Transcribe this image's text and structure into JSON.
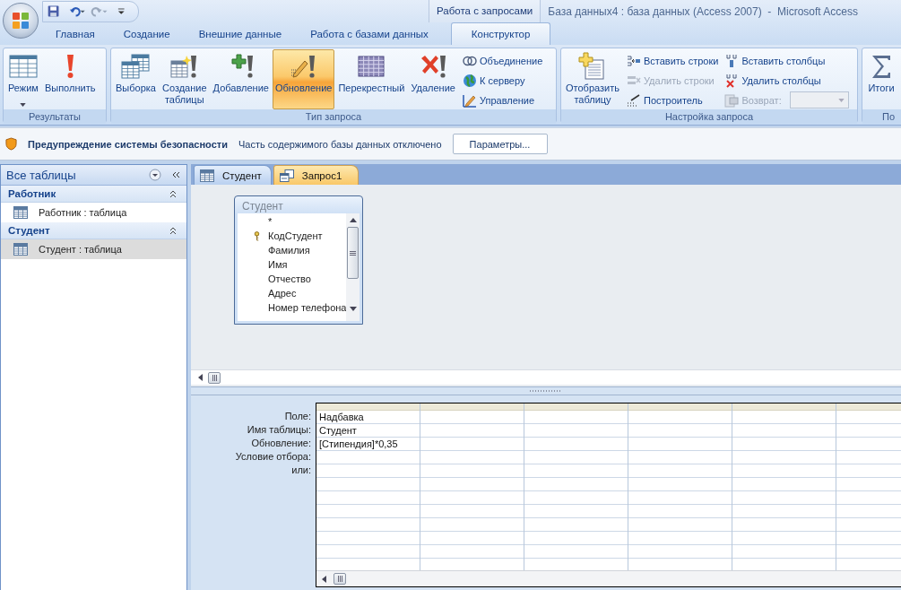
{
  "window": {
    "title": "База данных4 : база данных (Access 2007)  -  Microsoft Access",
    "context_label": "Работа с запросами"
  },
  "quick_access": [
    {
      "kind": "save",
      "disabled": false
    },
    {
      "kind": "undo",
      "disabled": false
    },
    {
      "kind": "redo",
      "disabled": true
    },
    {
      "kind": "customize",
      "disabled": false
    }
  ],
  "ribbon_tabs": [
    {
      "label": "Главная",
      "selected": false
    },
    {
      "label": "Создание",
      "selected": false
    },
    {
      "label": "Внешние данные",
      "selected": false
    },
    {
      "label": "Работа с базами данных",
      "selected": false
    },
    {
      "label": "Конструктор",
      "selected": true
    }
  ],
  "ribbon_groups": [
    {
      "label": "Результаты",
      "items": [
        {
          "kind": "large",
          "label": "Режим",
          "dropdown": true,
          "selected": false
        },
        {
          "kind": "large",
          "label": "Выполнить",
          "dropdown": false,
          "selected": false
        }
      ]
    },
    {
      "label": "Тип запроса",
      "items": [
        {
          "kind": "large",
          "label": "Выборка",
          "dropdown": false,
          "selected": false
        },
        {
          "kind": "large",
          "label": "Создание\nтаблицы",
          "dropdown": false,
          "selected": false
        },
        {
          "kind": "large",
          "label": "Добавление",
          "dropdown": false,
          "selected": false
        },
        {
          "kind": "large",
          "label": "Обновление",
          "dropdown": false,
          "selected": true
        },
        {
          "kind": "large",
          "label": "Перекрестный",
          "dropdown": false,
          "selected": false
        },
        {
          "kind": "large",
          "label": "Удаление",
          "dropdown": false,
          "selected": false
        },
        {
          "kind": "stack",
          "items": [
            {
              "kind": "small",
              "label": "Объединение",
              "disabled": false
            },
            {
              "kind": "small",
              "label": "К серверу",
              "disabled": false
            },
            {
              "kind": "small",
              "label": "Управление",
              "disabled": false
            }
          ]
        }
      ]
    },
    {
      "label": "Настройка запроса",
      "items": [
        {
          "kind": "large",
          "label": "Отобразить\nтаблицу",
          "dropdown": false,
          "selected": false
        },
        {
          "kind": "stack",
          "items": [
            {
              "kind": "small",
              "label": "Вставить строки",
              "disabled": false
            },
            {
              "kind": "small",
              "label": "Удалить строки",
              "disabled": true
            },
            {
              "kind": "small",
              "label": "Построитель",
              "disabled": false
            }
          ]
        },
        {
          "kind": "stack",
          "items": [
            {
              "kind": "small",
              "label": "Вставить столбцы",
              "disabled": false
            },
            {
              "kind": "small",
              "label": "Удалить столбцы",
              "disabled": false
            },
            {
              "kind": "combo",
              "label": "Возврат:",
              "disabled": true
            }
          ]
        }
      ]
    },
    {
      "label": "По",
      "items": [
        {
          "kind": "large",
          "label": "Итоги",
          "dropdown": false,
          "selected": false
        }
      ]
    }
  ],
  "security_bar": {
    "title": "Предупреждение системы безопасности",
    "message": "Часть содержимого базы данных отключено",
    "button": "Параметры..."
  },
  "navigation": {
    "title": "Все таблицы",
    "groups": [
      {
        "label": "Работник",
        "expanded": true,
        "items": [
          {
            "label": "Работник : таблица",
            "selected": false
          }
        ]
      },
      {
        "label": "Студент",
        "expanded": true,
        "items": [
          {
            "label": "Студент : таблица",
            "selected": true
          }
        ]
      }
    ]
  },
  "doc_tabs": [
    {
      "label": "Студент",
      "kind": "table",
      "selected": false
    },
    {
      "label": "Запрос1",
      "kind": "query",
      "selected": true
    }
  ],
  "field_list": {
    "title": "Студент",
    "fields": [
      {
        "name": "*",
        "primary_key": false
      },
      {
        "name": "КодСтудент",
        "primary_key": true
      },
      {
        "name": "Фамилия",
        "primary_key": false
      },
      {
        "name": "Имя",
        "primary_key": false
      },
      {
        "name": "Отчество",
        "primary_key": false
      },
      {
        "name": "Адрес",
        "primary_key": false
      },
      {
        "name": "Номер телефона",
        "primary_key": false
      }
    ]
  },
  "design_grid": {
    "row_labels": [
      "Поле:",
      "Имя таблицы:",
      "Обновление:",
      "Условие отбора:",
      "или:"
    ],
    "columns": [
      {
        "field": "Надбавка",
        "table": "Студент",
        "update": "[Стипендия]*0,35"
      }
    ]
  }
}
